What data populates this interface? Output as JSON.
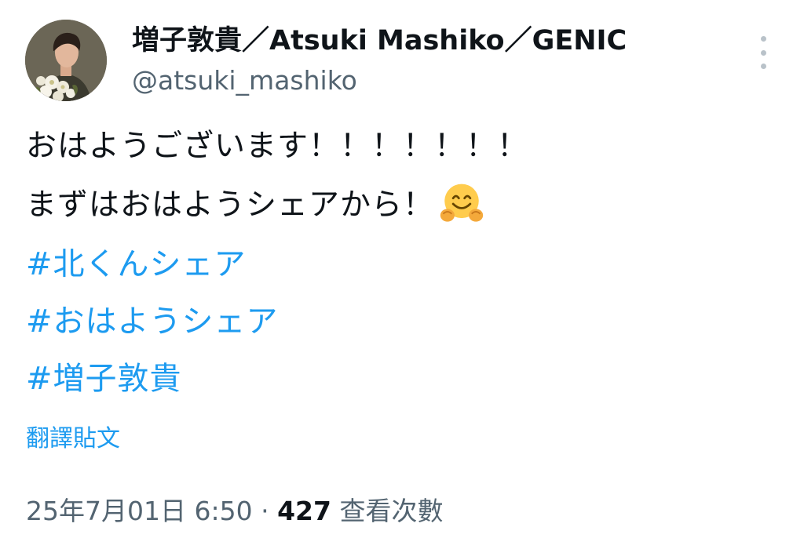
{
  "author": {
    "display_name": "増子敦貴／Atsuki Mashiko／GENIC",
    "handle": "@atsuki_mashiko",
    "avatar": "profile-photo"
  },
  "more_icon": "vertical-ellipsis-icon",
  "tweet": {
    "line1": "おはようございます！！！！！！！",
    "line2": "まずはおはようシェアから！",
    "line2_emoji": "hugging-face-emoji",
    "hashtags": [
      "#北くんシェア",
      "#おはようシェア",
      "#増子敦貴"
    ]
  },
  "translate_label": "翻譯貼文",
  "meta": {
    "timestamp": "25年7月01日 6:50",
    "separator": "·",
    "views_count": "427",
    "views_label": "查看次數"
  },
  "colors": {
    "link": "#1d9bf0",
    "secondary_text": "#536471",
    "primary_text": "#0f1419"
  }
}
